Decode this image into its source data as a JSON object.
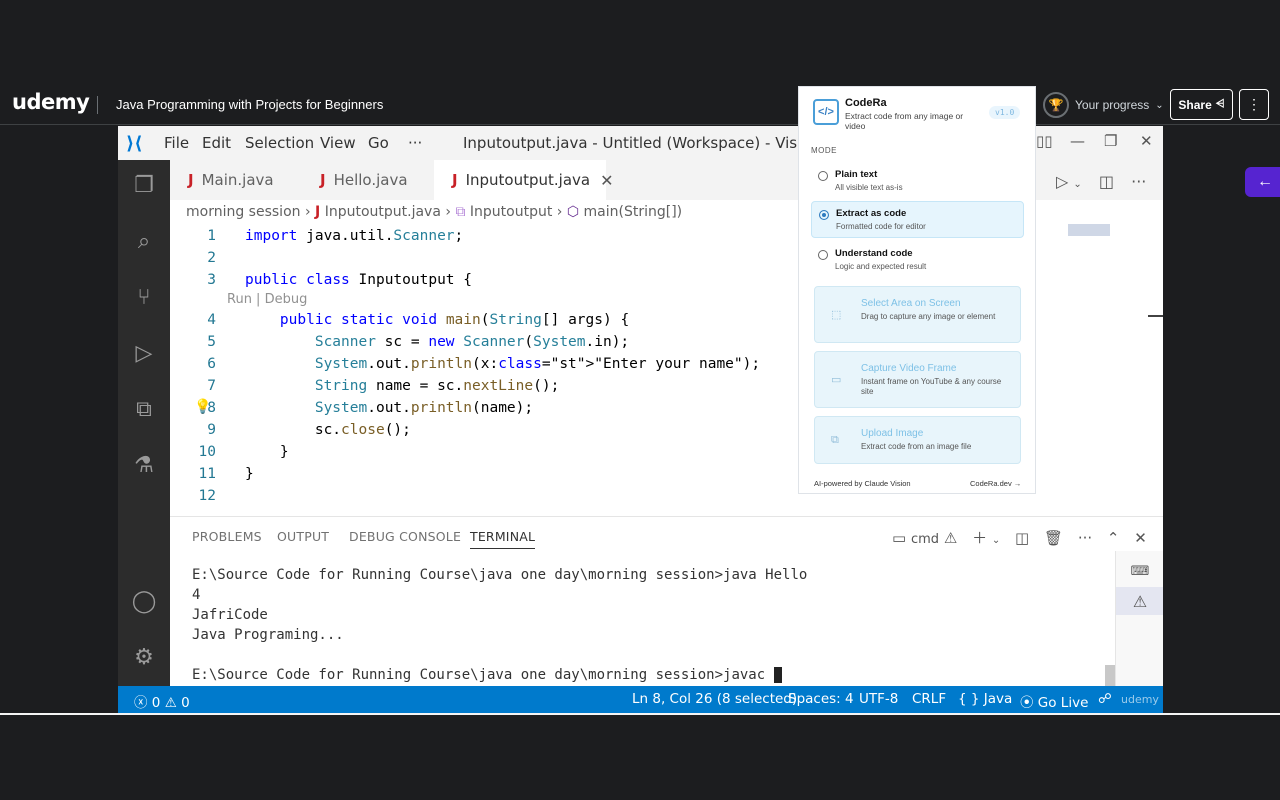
{
  "udemy": {
    "logo": "udemy",
    "course_title": "Java Programming with Projects for Beginners",
    "progress_label": "Your progress",
    "share_label": "Share"
  },
  "vscode": {
    "menu": [
      "File",
      "Edit",
      "Selection",
      "View",
      "Go",
      "···"
    ],
    "title": "Inputoutput.java - Untitled (Workspace) - Visual Studio Co",
    "tabs": [
      {
        "label": "Main.java",
        "active": false
      },
      {
        "label": "Hello.java",
        "active": false
      },
      {
        "label": "Inputoutput.java",
        "active": true
      }
    ],
    "breadcrumb": {
      "folder": "morning session",
      "file": "Inputoutput.java",
      "class": "Inputoutput",
      "method": "main(String[])"
    },
    "codelens": "Run | Debug",
    "line_numbers": [
      "1",
      "2",
      "3",
      "4",
      "5",
      "6",
      "7",
      "8",
      "9",
      "10",
      "11",
      "12"
    ],
    "code_lines": [
      "import java.util.Scanner;",
      "",
      "public class Inputoutput {",
      "    public static void main(String[] args) {",
      "        Scanner sc = new Scanner(System.in);",
      "        System.out.println(x:\"Enter your name\");",
      "        String name = sc.nextLine();",
      "        System.out.println(name);",
      "        sc.close();",
      "    }",
      "}",
      ""
    ],
    "panel_tabs": [
      "PROBLEMS",
      "OUTPUT",
      "DEBUG CONSOLE",
      "TERMINAL"
    ],
    "terminal_shell": "cmd",
    "terminal_lines": [
      "E:\\Source Code for Running Course\\java one day\\morning session>java Hello",
      "4",
      "JafriCode",
      "Java Programing...",
      "",
      "E:\\Source Code for Running Course\\java one day\\morning session>javac "
    ],
    "status": {
      "errors": "0",
      "warnings": "0",
      "position": "Ln 8, Col 26 (8 selected)",
      "spaces": "Spaces: 4",
      "encoding": "UTF-8",
      "eol": "CRLF",
      "language": "Java",
      "golive": "Go Live",
      "watermark": "udemy"
    }
  },
  "codera": {
    "name": "CodeRa",
    "tagline": "Extract code from any image or video",
    "version": "v1.0",
    "mode_label": "MODE",
    "modes": [
      {
        "title": "Plain text",
        "desc": "All visible text as-is",
        "selected": false
      },
      {
        "title": "Extract as code",
        "desc": "Formatted code for editor",
        "selected": true
      },
      {
        "title": "Understand code",
        "desc": "Logic and expected result",
        "selected": false
      }
    ],
    "actions": [
      {
        "title": "Select Area on Screen",
        "desc": "Drag to capture any image or element",
        "icon": "select-area-icon"
      },
      {
        "title": "Capture Video Frame",
        "desc": "Instant frame on YouTube & any course site",
        "icon": "video-icon"
      },
      {
        "title": "Upload Image",
        "desc": "Extract code from an image file",
        "icon": "upload-icon"
      }
    ],
    "powered_by": "AI-powered by Claude Vision",
    "link": "CodeRa.dev →"
  },
  "colors": {
    "udemy_bg": "#1c1d1f",
    "udemy_purple": "#5624d0",
    "vscode_status": "#007acc",
    "java_icon": "#c82127"
  }
}
